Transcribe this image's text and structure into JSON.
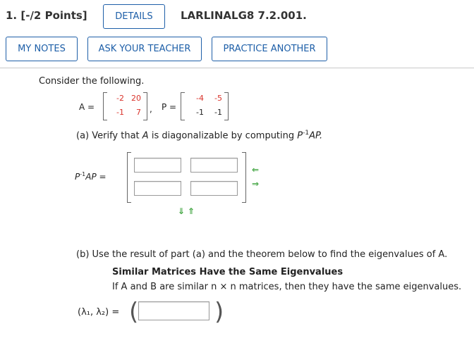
{
  "header": {
    "question_number": "1.",
    "points": "[-/2 Points]",
    "details_label": "DETAILS",
    "problem_code": "LARLINALG8 7.2.001."
  },
  "toolbar": {
    "my_notes_label": "MY NOTES",
    "ask_teacher_label": "ASK YOUR TEACHER",
    "practice_another_label": "PRACTICE ANOTHER"
  },
  "problem": {
    "intro": "Consider the following.",
    "A_label": "A =",
    "P_label": "P =",
    "A_matrix": [
      [
        "-2",
        "20"
      ],
      [
        "-1",
        "7"
      ]
    ],
    "P_matrix": [
      [
        "-4",
        "-5"
      ],
      [
        "-1",
        "-1"
      ]
    ],
    "comma": ",",
    "part_a_prefix": "(a) Verify that ",
    "part_a_var": "A",
    "part_a_mid": " is diagonalizable by computing ",
    "part_a_expr": "P",
    "part_a_sup": "-1",
    "part_a_end": "AP.",
    "result_label_p": "P",
    "result_label_sup": "-1",
    "result_label_end": "AP =",
    "part_b": "(b) Use the result of part (a) and the theorem below to find the eigenvalues of A.",
    "theorem_title": "Similar Matrices Have the Same Eigenvalues",
    "theorem_body": "If A and B are similar n × n matrices, then they have the same eigenvalues.",
    "eigen_label": "(λ₁, λ₂) =",
    "arrows": {
      "left": "⇐",
      "right": "⇒",
      "down": "⇓",
      "up": "⇑"
    }
  }
}
